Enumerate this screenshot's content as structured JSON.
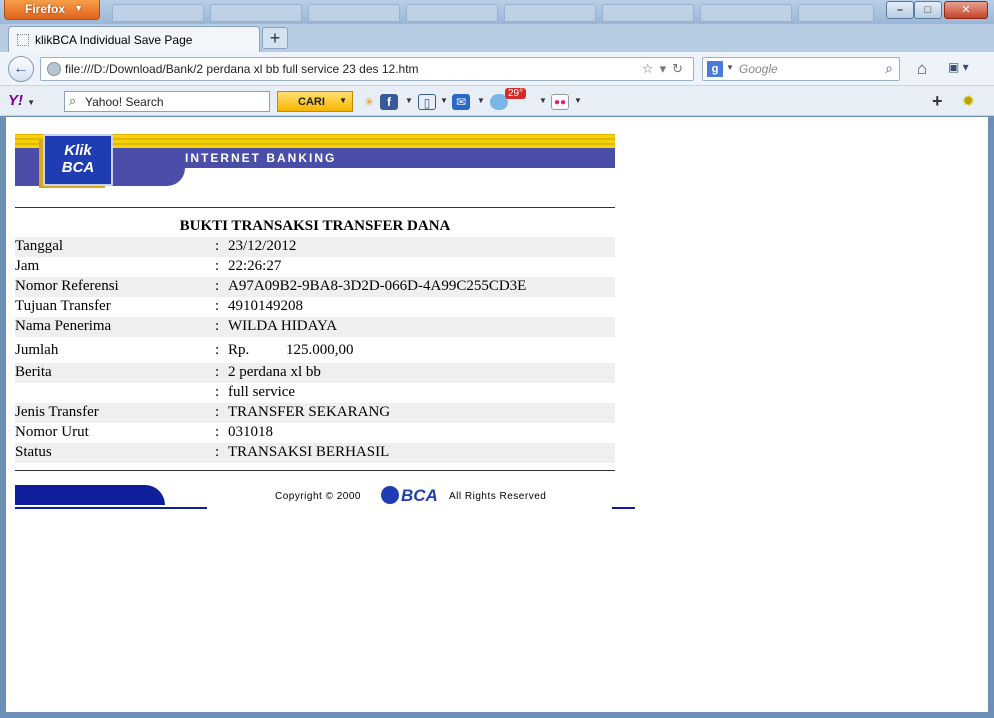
{
  "browser": {
    "menu_button": "Firefox",
    "tab_title": "klikBCA Individual Save Page",
    "new_tab": "+",
    "url": "file:///D:/Download/Bank/2 perdana xl bb full service 23 des 12.htm",
    "search_engine_placeholder": "Google",
    "yahoo_search_value": "Yahoo! Search",
    "cari_label": "CARI",
    "weather_badge": "29°"
  },
  "bca_header": {
    "logo_text_line1": "Klik",
    "logo_text_line2": "BCA",
    "banner": "INTERNET BANKING"
  },
  "receipt": {
    "title": "BUKTI TRANSAKSI TRANSFER DANA",
    "rows": [
      {
        "label": "Tanggal",
        "value": "23/12/2012"
      },
      {
        "label": "Jam",
        "value": "22:26:27"
      },
      {
        "label": "Nomor Referensi",
        "value": "A97A09B2-9BA8-3D2D-066D-4A99C255CD3E"
      },
      {
        "label": "Tujuan Transfer",
        "value": "4910149208"
      },
      {
        "label": "Nama Penerima",
        "value": "WILDA HIDAYA"
      },
      {
        "label": "Jumlah",
        "currency": "Rp.",
        "value": "125.000,00"
      },
      {
        "label": "Berita",
        "value": "2 perdana xl bb"
      },
      {
        "label": "",
        "value": "full service"
      },
      {
        "label": "Jenis Transfer",
        "value": "TRANSFER SEKARANG"
      },
      {
        "label": "Nomor Urut",
        "value": "031018"
      },
      {
        "label": "Status",
        "value": "TRANSAKSI BERHASIL"
      }
    ]
  },
  "footer": {
    "copyright": "Copyright © 2000",
    "logo": "BCA",
    "rights": "All Rights Reserved"
  }
}
